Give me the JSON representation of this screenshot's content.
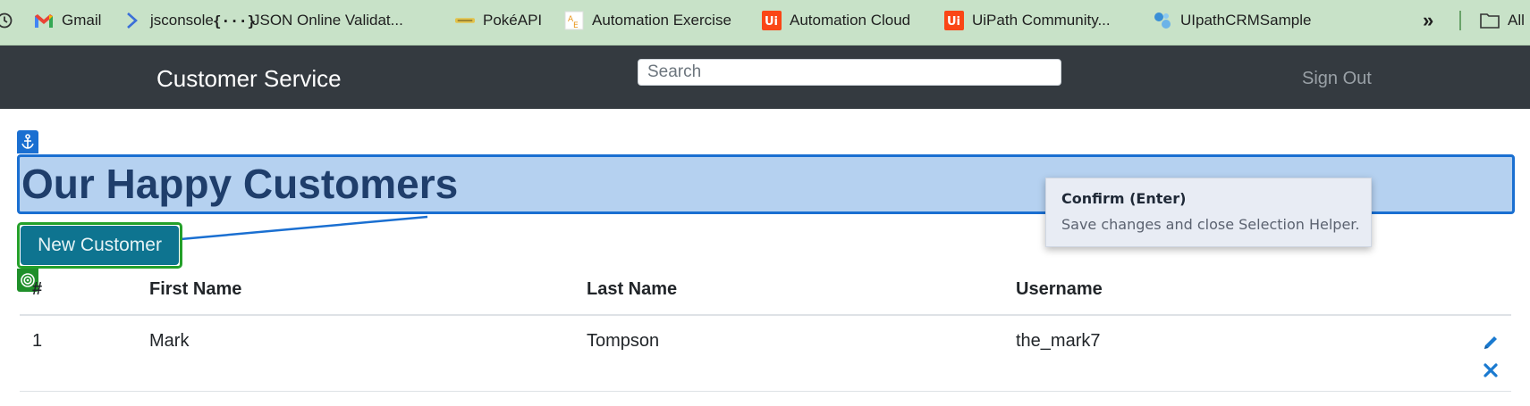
{
  "bookmarks": {
    "items": [
      {
        "label": "Gmail",
        "icon": "gmail-icon"
      },
      {
        "label": "jsconsole",
        "icon": "chevron-right-icon"
      },
      {
        "label": "JSON Online Validat...",
        "icon": "braces-icon"
      },
      {
        "label": "PokéAPI",
        "icon": "pokeapi-icon"
      },
      {
        "label": "Automation Exercise",
        "icon": "automation-exercise-icon"
      },
      {
        "label": "Automation Cloud",
        "icon": "uipath-icon"
      },
      {
        "label": "UiPath Community...",
        "icon": "uipath-icon"
      },
      {
        "label": "UIpathCRMSample",
        "icon": "crm-icon"
      }
    ],
    "overflow_label": "»",
    "folder_label": "All"
  },
  "navbar": {
    "brand": "Customer Service",
    "search_placeholder": "Search",
    "signout": "Sign Out"
  },
  "page": {
    "heading": "Our Happy Customers",
    "new_customer_button": "New Customer"
  },
  "table": {
    "columns": [
      "#",
      "First Name",
      "Last Name",
      "Username"
    ],
    "rows": [
      {
        "id": "1",
        "first_name": "Mark",
        "last_name": "Tompson",
        "username": "the_mark7"
      }
    ]
  },
  "tooltip": {
    "title": "Confirm (Enter)",
    "description": "Save changes and close Selection Helper."
  },
  "colors": {
    "bookmark_bar": "#c8e2c8",
    "navbar": "#343a40",
    "selection_blue": "#1a6fd1",
    "target_green": "#24a02a",
    "button_teal": "#0e7490",
    "action_blue": "#1a7ad0"
  }
}
